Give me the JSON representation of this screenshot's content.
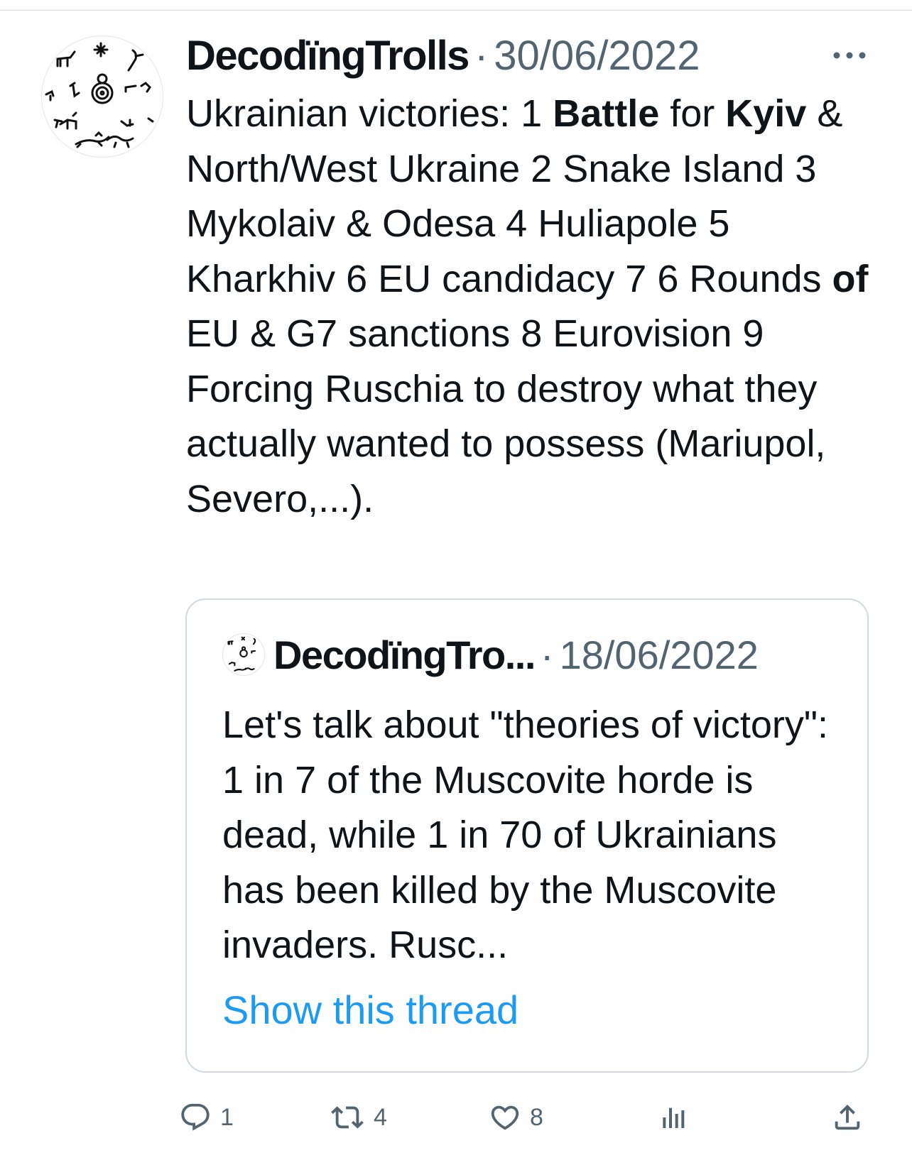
{
  "tweet": {
    "author": "DecodïngTrolls",
    "separator": "·",
    "date": "30/06/2022",
    "more_icon": "ellipsis-icon",
    "text_parts": [
      {
        "text": "Ukrainian victories: 1 ",
        "bold": false
      },
      {
        "text": "Battle",
        "bold": true
      },
      {
        "text": " for ",
        "bold": false
      },
      {
        "text": "Kyiv",
        "bold": true
      },
      {
        "text": " & North/West Ukraine 2 Snake Island 3 Mykolaiv & Odesa 4 Huliapole 5 Kharkhiv 6 EU candidacy 7 6 Rounds ",
        "bold": false
      },
      {
        "text": "of",
        "bold": true
      },
      {
        "text": " EU & G7 sanctions 8 Eurovision 9 Forcing Ruschia to destroy what they actually wanted to possess (Mariupol, Severo,...).",
        "bold": false
      }
    ]
  },
  "quote": {
    "author": "DecodïngTro...",
    "separator": "·",
    "date": "18/06/2022",
    "text": "Let's talk about \"theories of victory\": 1 in 7 of the Muscovite horde is dead, while 1 in 70 of Ukrainians has been killed by the Muscovite invaders. Rusc...",
    "show_thread": "Show this thread"
  },
  "actions": {
    "reply": {
      "icon": "reply-icon",
      "count": "1"
    },
    "retweet": {
      "icon": "retweet-icon",
      "count": "4"
    },
    "like": {
      "icon": "heart-icon",
      "count": "8"
    },
    "views": {
      "icon": "views-icon"
    },
    "share": {
      "icon": "share-icon"
    }
  },
  "colors": {
    "text": "#0f1419",
    "secondary": "#536471",
    "link": "#1d9bf0",
    "border": "#cfd9de"
  }
}
